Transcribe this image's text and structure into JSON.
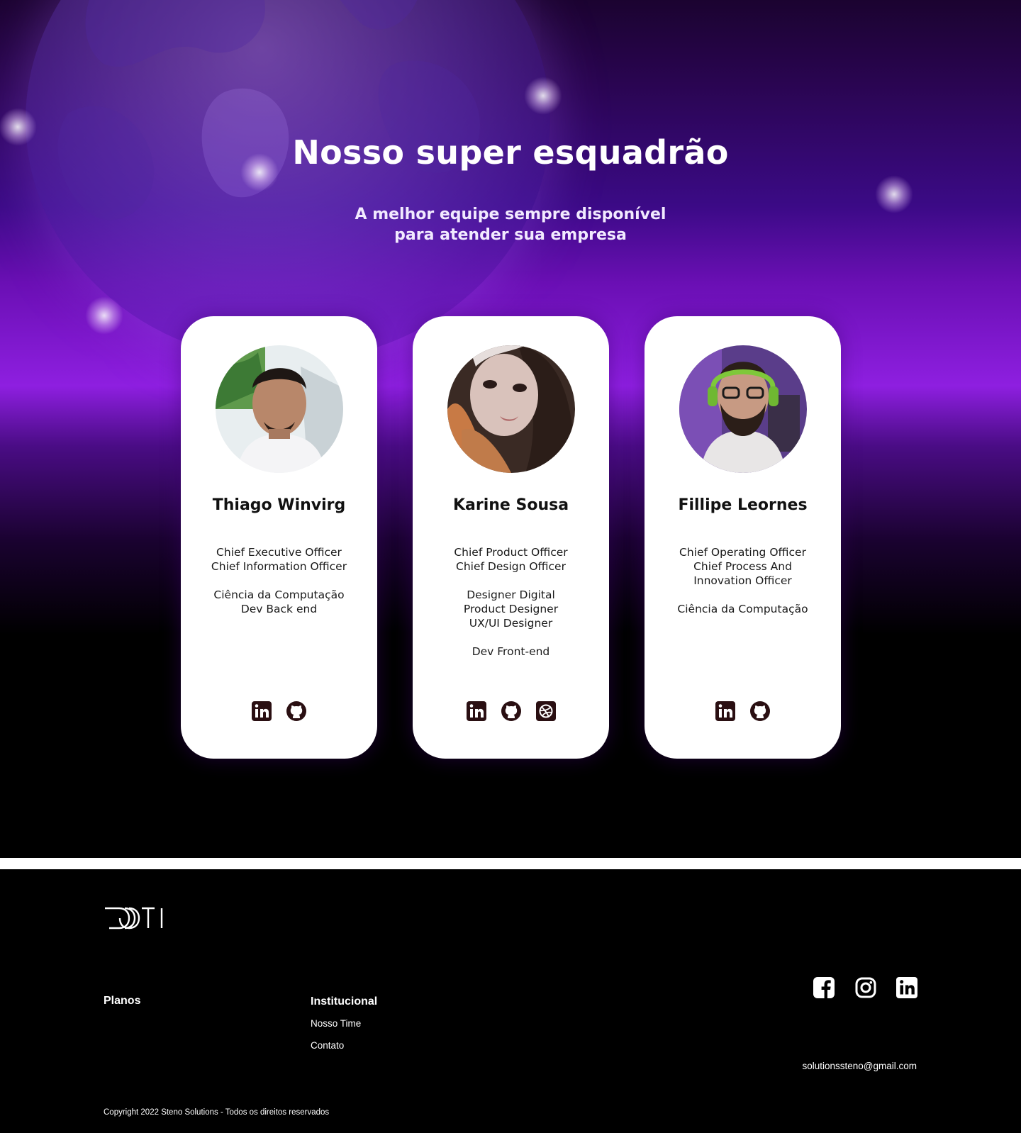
{
  "hero": {
    "title": "Nosso super esquadrão",
    "subtitle_line1": "A melhor equipe sempre disponível",
    "subtitle_line2": "para atender sua empresa"
  },
  "team": [
    {
      "name": "Thiago Winvirg",
      "role_groups": [
        [
          "Chief Executive Officer",
          "Chief Information Officer"
        ],
        [
          "Ciência da Computação",
          "Dev Back end"
        ]
      ],
      "socials": [
        "linkedin-icon",
        "github-icon"
      ]
    },
    {
      "name": "Karine Sousa",
      "role_groups": [
        [
          "Chief Product Officer",
          "Chief Design Officer"
        ],
        [
          "Designer Digital",
          "Product Designer",
          "UX/UI Designer"
        ],
        [
          "Dev Front-end"
        ]
      ],
      "socials": [
        "linkedin-icon",
        "github-icon",
        "dribbble-icon"
      ]
    },
    {
      "name": "Fillipe Leornes",
      "role_groups": [
        [
          "Chief Operating Officer",
          "Chief Process And",
          "Innovation Officer"
        ],
        [
          "Ciência da Computação"
        ]
      ],
      "socials": [
        "linkedin-icon",
        "github-icon"
      ]
    }
  ],
  "footer": {
    "logo_alt": "DOTI",
    "plans_title": "Planos",
    "institutional_title": "Institucional",
    "links": [
      "Nosso Time",
      "Contato"
    ],
    "socials": [
      "facebook-icon",
      "instagram-icon",
      "linkedin-icon"
    ],
    "email": "solutionssteno@gmail.com",
    "copyright": "Copyright 2022 Steno Solutions - Todos os direitos reservados"
  },
  "colors": {
    "hero_purple": "#8e1fe0",
    "icon_dark": "#2a0f12",
    "background": "#000000",
    "card": "#ffffff"
  }
}
